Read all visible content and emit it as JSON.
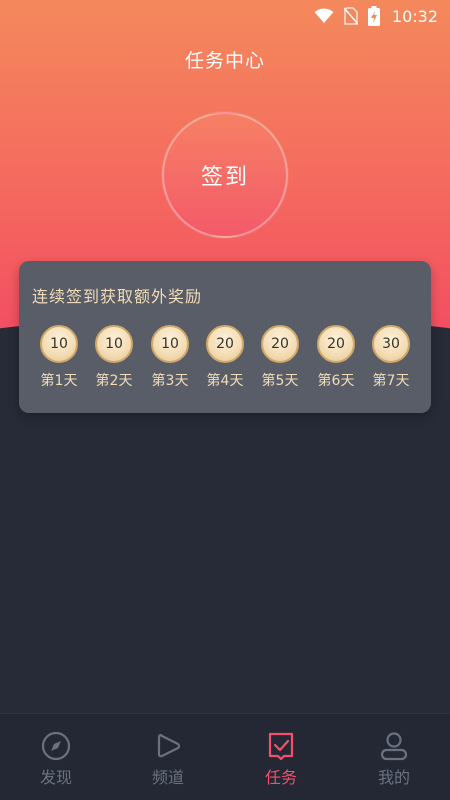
{
  "status_bar": {
    "time": "10:32"
  },
  "header": {
    "title": "任务中心"
  },
  "signin": {
    "label": "签到"
  },
  "reward": {
    "title": "连续签到获取额外奖励",
    "days": [
      {
        "value": "10",
        "label": "第1天"
      },
      {
        "value": "10",
        "label": "第2天"
      },
      {
        "value": "10",
        "label": "第3天"
      },
      {
        "value": "20",
        "label": "第4天"
      },
      {
        "value": "20",
        "label": "第5天"
      },
      {
        "value": "20",
        "label": "第6天"
      },
      {
        "value": "30",
        "label": "第7天"
      }
    ]
  },
  "tabbar": {
    "tabs": [
      {
        "label": "发现",
        "icon": "compass-icon",
        "active": false
      },
      {
        "label": "频道",
        "icon": "play-icon",
        "active": false
      },
      {
        "label": "任务",
        "icon": "task-check-icon",
        "active": true
      },
      {
        "label": "我的",
        "icon": "person-icon",
        "active": false
      }
    ]
  },
  "colors": {
    "accent": "#f4506a",
    "hero_top": "#f4895c",
    "hero_bottom": "#f24f62",
    "background": "#262b37",
    "card": "#585d68",
    "gold_text": "#f2dcb6",
    "tab_inactive": "#6b7180"
  }
}
